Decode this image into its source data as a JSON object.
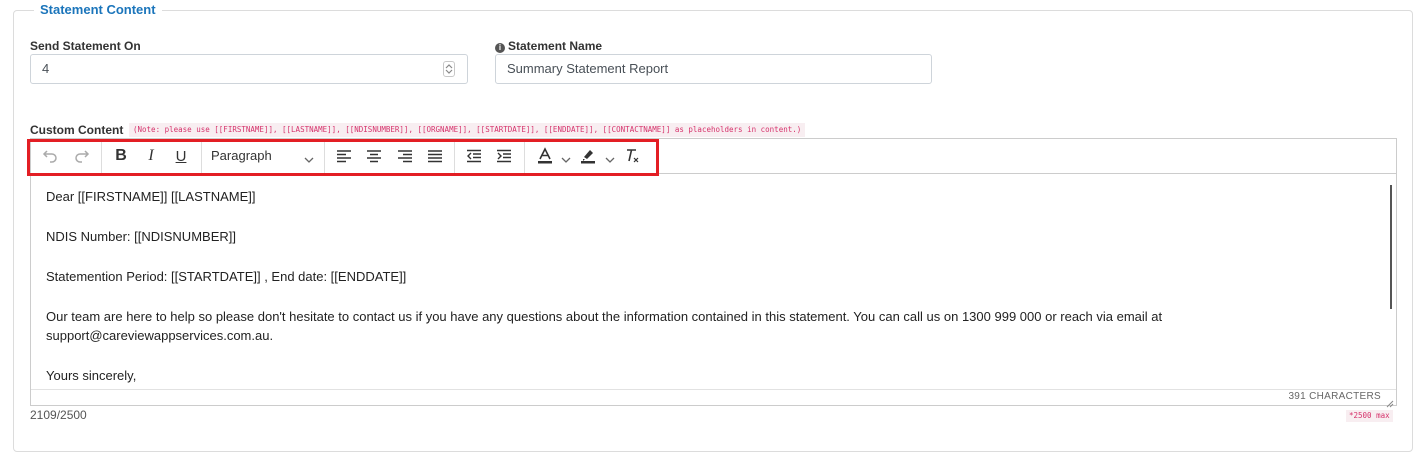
{
  "section": {
    "title": "Statement Content"
  },
  "send_on": {
    "label": "Send Statement On",
    "value": "4"
  },
  "statement_name": {
    "label": "Statement Name",
    "value": "Summary Statement Report",
    "info_icon": "info-circle-icon"
  },
  "custom_content": {
    "label": "Custom Content",
    "note": "(Note: please use [[FIRSTNAME]], [[LASTNAME]], [[NDISNUMBER]], [[ORGNAME]], [[STARTDATE]], [[ENDDATE]], [[CONTACTNAME]] as placeholders in content.)"
  },
  "toolbar": {
    "block_format": "Paragraph",
    "icons": [
      "undo-icon",
      "redo-icon",
      "bold-icon",
      "italic-icon",
      "underline-icon",
      "align-left-icon",
      "align-center-icon",
      "align-right-icon",
      "align-justify-icon",
      "outdent-icon",
      "indent-icon",
      "text-color-icon",
      "highlight-color-icon",
      "clear-formatting-icon"
    ]
  },
  "editor": {
    "paragraphs": [
      "Dear [[FIRSTNAME]]  [[LASTNAME]]",
      "NDIS Number: [[NDISNUMBER]]",
      "Statemention Period: [[STARTDATE]] , End date: [[ENDDATE]]",
      "Our team are here to help so please don't hesitate to contact us if you have any questions about the information contained in this statement. You can call us on 1300 999 000 or reach via email at support@careviewappservices.com.au.",
      "Yours sincerely,"
    ],
    "char_count": "391 CHARACTERS"
  },
  "counter": {
    "value": "2109/2500",
    "max_note": "*2500 max"
  },
  "colors": {
    "accent": "#1b75bb",
    "highlight_border": "#e31e24",
    "note_text": "#d6336c"
  }
}
